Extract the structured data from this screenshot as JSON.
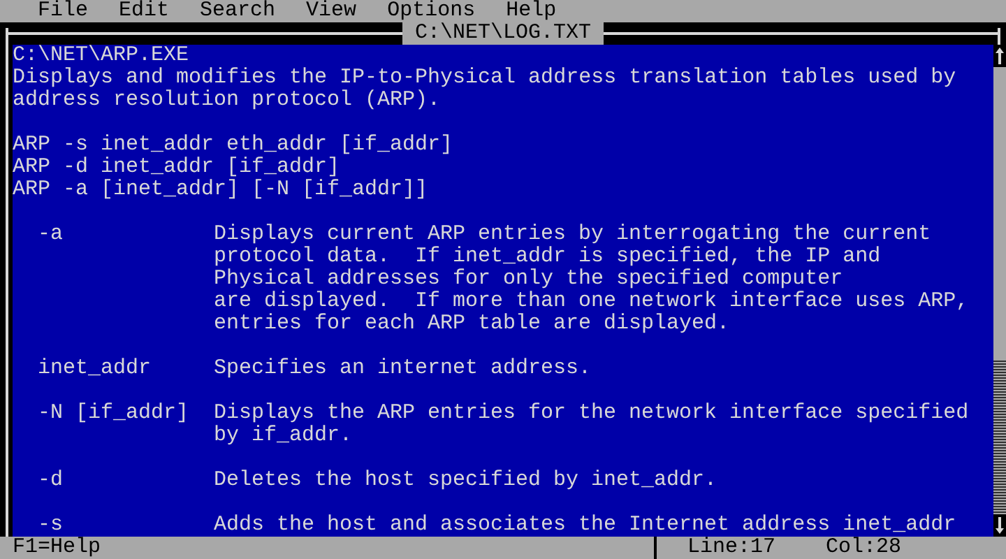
{
  "menu_bar": {
    "items": [
      "File",
      "Edit",
      "Search",
      "View",
      "Options",
      "Help"
    ]
  },
  "window": {
    "title": "C:\\NET\\LOG.TXT"
  },
  "editor": {
    "lines": [
      {
        "kind": "text",
        "text": "C:\\NET\\ARP.EXE"
      },
      {
        "kind": "text",
        "text": "Displays and modifies the IP-to-Physical address translation tables used by"
      },
      {
        "kind": "text",
        "text": "address resolution protocol (ARP)."
      },
      {
        "kind": "blank"
      },
      {
        "kind": "text",
        "text": "ARP -s inet_addr eth_addr [if_addr]"
      },
      {
        "kind": "text",
        "text": "ARP -d inet_addr [if_addr]"
      },
      {
        "kind": "text",
        "text": "ARP -a [inet_addr] [-N [if_addr]]"
      },
      {
        "kind": "blank"
      },
      {
        "kind": "entry",
        "term": "-a",
        "description": [
          "Displays current ARP entries by interrogating the current",
          "protocol data.  If inet_addr is specified, the IP and",
          "Physical addresses for only the specified computer",
          "are displayed.  If more than one network interface uses ARP,",
          "entries for each ARP table are displayed."
        ]
      },
      {
        "kind": "blank"
      },
      {
        "kind": "entry",
        "term": "inet_addr",
        "description": [
          "Specifies an internet address."
        ]
      },
      {
        "kind": "blank"
      },
      {
        "kind": "entry",
        "term": "-N [if_addr]",
        "description": [
          "Displays the ARP entries for the network interface specified",
          "by if_addr."
        ]
      },
      {
        "kind": "blank"
      },
      {
        "kind": "entry",
        "term": "-d",
        "description": [
          "Deletes the host specified by inet_addr."
        ]
      },
      {
        "kind": "blank"
      },
      {
        "kind": "entry",
        "term": "-s",
        "description": [
          "Adds the host and associates the Internet address inet_addr"
        ]
      }
    ]
  },
  "status_bar": {
    "help": "F1=Help",
    "line": "Line:17",
    "column": "Col:28"
  }
}
